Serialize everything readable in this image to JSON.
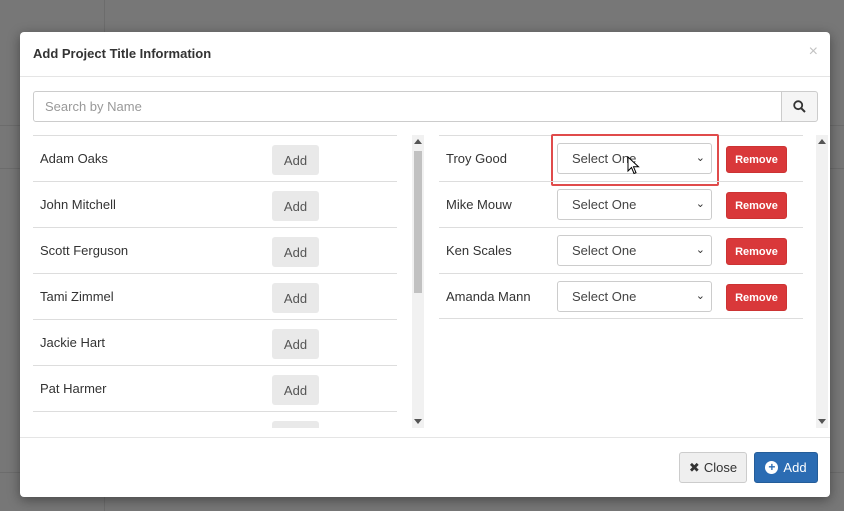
{
  "modal": {
    "title": "Add Project Title Information",
    "close_glyph": "×"
  },
  "search": {
    "placeholder": "Search by Name",
    "icon": "search-icon"
  },
  "available": {
    "add_label": "Add",
    "people": [
      "Adam Oaks",
      "John Mitchell",
      "Scott Ferguson",
      "Tami Zimmel",
      "Jackie Hart",
      "Pat Harmer"
    ]
  },
  "selected": {
    "select_value": "Select One",
    "remove_label": "Remove",
    "people": [
      "Troy Good",
      "Mike Mouw",
      "Ken Scales",
      "Amanda Mann"
    ]
  },
  "footer": {
    "close_label": "Close",
    "add_label": "Add"
  },
  "colors": {
    "remove": "#d9383a",
    "primary": "#2b6cb3",
    "highlight": "#e04b4b"
  }
}
